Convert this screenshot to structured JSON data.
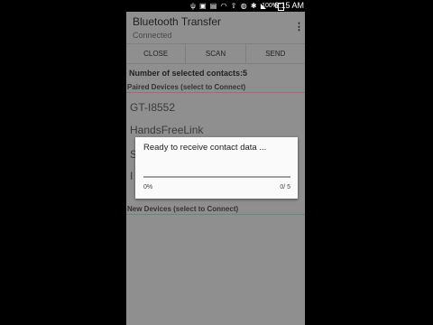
{
  "status_bar": {
    "icons": [
      "usb-icon",
      "image-icon",
      "sim-icon",
      "wifi-icon",
      "upload-icon",
      "android-icon",
      "bluetooth-icon",
      "signal-icon"
    ],
    "icon_glyphs": "ψ ▣ ▤ ◠ ⇧ ◍ ✱ ◣",
    "battery": "100%",
    "time": "6:15 AM"
  },
  "action_bar": {
    "title": "Bluetooth Transfer",
    "subtitle": "Connected",
    "overflow_glyph": "⋮"
  },
  "buttons": {
    "close": "CLOSE",
    "scan": "SCAN",
    "send": "SEND"
  },
  "selected_contacts": "Number of selected contacts:5",
  "paired_header": "Paired Devices (select to Connect)",
  "devices": [
    "GT-I8552",
    "HandsFreeLink",
    "S",
    "I"
  ],
  "new_header": "New Devices (select to Connect)",
  "dialog": {
    "message": "Ready to receive contact data ...",
    "progress_fraction": 0,
    "percent": "0%",
    "count": "0/ 5"
  }
}
